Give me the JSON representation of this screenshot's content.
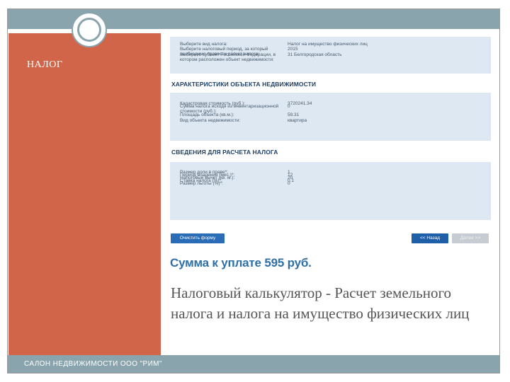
{
  "slide": {
    "title": "НАЛОГ",
    "footer": "САЛОН НЕДВИЖИМОСТИ ООО \"РИМ\"",
    "caption": "Налоговый калькулятор - Расчет земельного налога и налога на имущество физических лиц"
  },
  "form": {
    "top_rows": [
      {
        "label": "Выберите вид налога:",
        "value": "Налог на имущество физических лиц"
      },
      {
        "label": "Выберите налоговый период, за который необходимо провести расчет налога:",
        "value": "2015"
      },
      {
        "label": "Выберите субъект Российской Федерации, в котором расположен объект недвижимости:",
        "value": "31 Белгородская область"
      }
    ],
    "property_section_title": "ХАРАКТЕРИСТИКИ ОБЪЕКТА НЕДВИЖИМОСТИ",
    "property_rows": [
      {
        "label": "Кадастровая стоимость (руб.):",
        "value": "3720241.34"
      },
      {
        "label": "Сумма налога исходя из инвентаризационной стоимости (руб.):",
        "value": "0"
      },
      {
        "label": "Площадь объекта (кв.м.):",
        "value": "59.31"
      },
      {
        "label": "Вид объекта недвижимости:",
        "value": "квартира"
      }
    ],
    "calc_section_title": "СВЕДЕНИЯ ДЛЯ РАСЧЕТА НАЛОГА",
    "calc_rows": [
      {
        "label": "Размер доли в праве*:",
        "value": "1"
      },
      {
        "label": "Период владения (мес.)*:",
        "value": "12"
      },
      {
        "label": "Налоговый вычет (кв. м.):",
        "value": "20"
      },
      {
        "label": "Ставка налога (%)*:",
        "value": "0.1"
      },
      {
        "label": "Размер льготы (%)*:",
        "value": "0"
      }
    ],
    "buttons": {
      "clear": "Очистить форму",
      "back": "<< Назад",
      "next": "Далее >>"
    },
    "total": "Сумма к уплате 595 руб."
  },
  "colors": {
    "accent_panel": "#d0654a",
    "bar": "#8aa4ad",
    "form_bg": "#dde8f2",
    "button_blue": "#2a6cb5",
    "total_text": "#2f6fa8"
  }
}
